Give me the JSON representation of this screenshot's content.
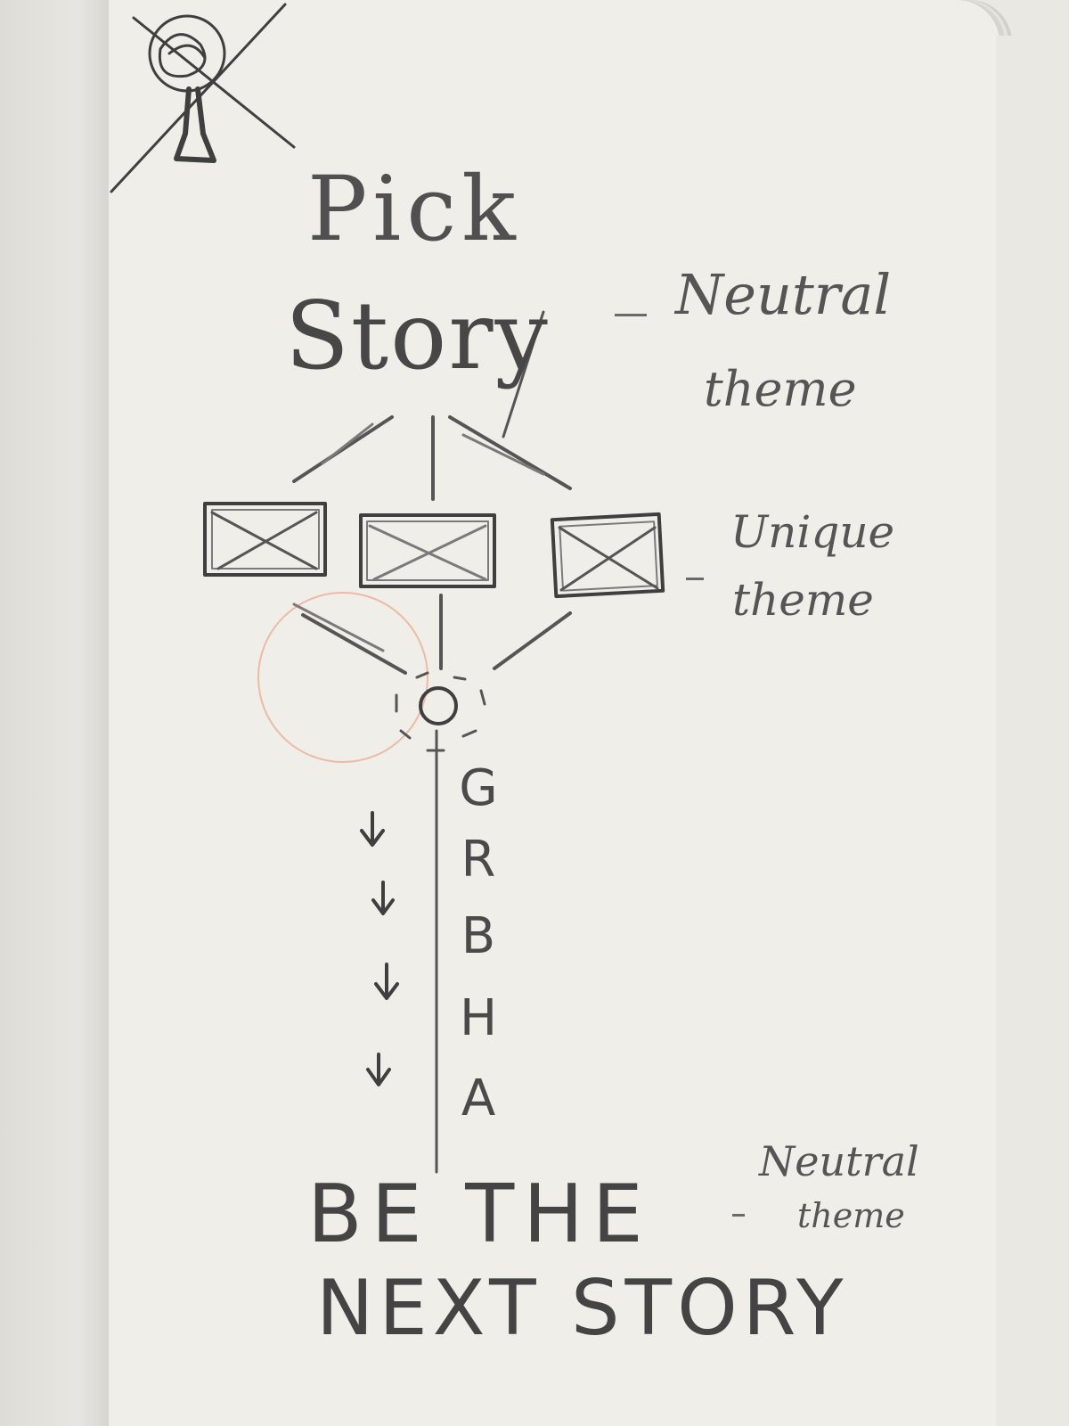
{
  "sketch": {
    "title_line1": "Pick",
    "title_line2": "Story",
    "title_note_line1": "Neutral",
    "title_note_line2": "theme",
    "options_note_line1": "Unique",
    "options_note_line2": "theme",
    "step_letters": [
      "G",
      "R",
      "B",
      "H",
      "A"
    ],
    "arrow_count": 4,
    "bottom_line1": "BE THE",
    "bottom_line2": "NEXT STORY",
    "bottom_note_line1": "Neutral",
    "bottom_note_line2": "theme",
    "placeholder_box_count": 3,
    "ink_color": "#4a4a4a",
    "paper_color": "#f0eee8",
    "stain_color": "#e8a58a"
  }
}
